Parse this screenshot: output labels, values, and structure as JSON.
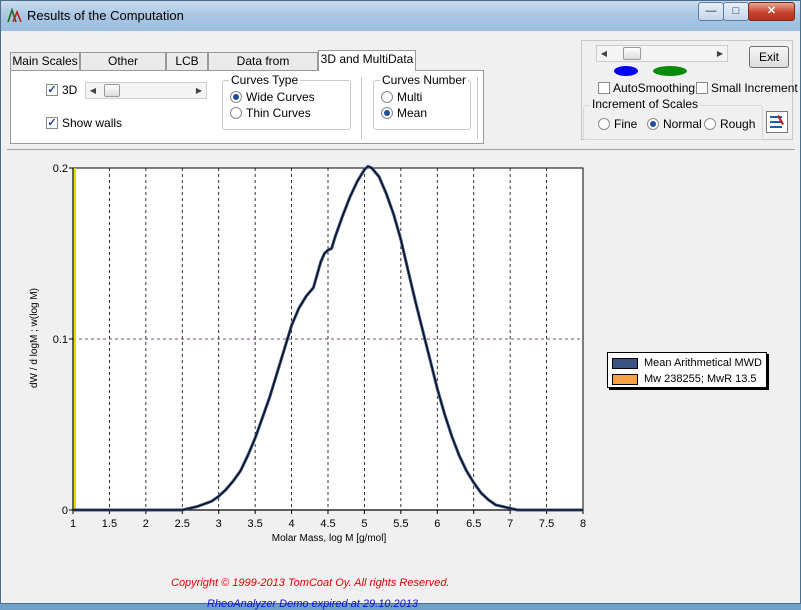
{
  "window": {
    "title": "Results of the Computation",
    "minimize_glyph": "—",
    "maximize_glyph": "□",
    "close_glyph": "✕"
  },
  "tabs": [
    {
      "label": "Main Scales",
      "active": false
    },
    {
      "label": "Other Functions",
      "active": false
    },
    {
      "label": "LCB",
      "active": false
    },
    {
      "label": "Data from DataBase",
      "active": false
    },
    {
      "label": "3D and MultiData",
      "active": true
    }
  ],
  "panel_3d": {
    "checkbox_3d": {
      "label": "3D",
      "checked": true
    },
    "checkbox_walls": {
      "label": "Show walls",
      "checked": true
    },
    "slider_position": 0.2,
    "curves_type": {
      "title": "Curves Type",
      "options": [
        {
          "label": "Wide Curves",
          "selected": true
        },
        {
          "label": "Thin Curves",
          "selected": false
        }
      ]
    },
    "curves_number": {
      "title": "Curves Number",
      "options": [
        {
          "label": "Multi",
          "selected": false
        },
        {
          "label": "Mean",
          "selected": true
        }
      ]
    }
  },
  "right_panel": {
    "exit_label": "Exit",
    "auto_smoothing_label": "AutoSmoothing",
    "small_increment_label": "Small Increment",
    "increment_title": "Increment of Scales",
    "increment_options": [
      {
        "label": "Fine",
        "selected": false
      },
      {
        "label": "Normal",
        "selected": true
      },
      {
        "label": "Rough",
        "selected": false
      }
    ],
    "slider_position": 0.2,
    "ellipse_colors": [
      "#0000ff",
      "#0a8a0a"
    ]
  },
  "chart_data": {
    "type": "line",
    "xlabel": "Molar Mass, log M [g/mol]",
    "ylabel": "dW / d logM ; w(log M)",
    "xlim": [
      1,
      8
    ],
    "ylim": [
      0,
      0.2
    ],
    "xticks": [
      "1",
      "1.5",
      "2",
      "2.5",
      "3",
      "3.5",
      "4",
      "4.5",
      "5",
      "5.5",
      "6",
      "6.5",
      "7",
      "7.5",
      "8"
    ],
    "yticks": [
      "0",
      "0.1",
      "0.2"
    ],
    "grid": true,
    "legend_placement": "right",
    "series": [
      {
        "name": "Mean Arithmetical MWD",
        "color": "#3a5384",
        "x": [
          1.0,
          2.5,
          2.7,
          2.9,
          3.0,
          3.1,
          3.2,
          3.3,
          3.4,
          3.5,
          3.6,
          3.7,
          3.8,
          3.9,
          4.0,
          4.1,
          4.2,
          4.3,
          4.4,
          4.45,
          4.5,
          4.55,
          4.6,
          4.7,
          4.8,
          4.9,
          5.0,
          5.05,
          5.1,
          5.2,
          5.3,
          5.4,
          5.5,
          5.6,
          5.7,
          5.8,
          5.9,
          6.0,
          6.1,
          6.2,
          6.3,
          6.4,
          6.5,
          6.6,
          6.7,
          6.8,
          6.9,
          7.0,
          7.1,
          7.2,
          8.0
        ],
        "y": [
          0.0,
          0.0,
          0.002,
          0.005,
          0.008,
          0.012,
          0.017,
          0.023,
          0.032,
          0.042,
          0.054,
          0.066,
          0.08,
          0.094,
          0.108,
          0.118,
          0.125,
          0.13,
          0.145,
          0.15,
          0.152,
          0.153,
          0.16,
          0.172,
          0.183,
          0.192,
          0.199,
          0.201,
          0.2,
          0.195,
          0.185,
          0.173,
          0.158,
          0.14,
          0.122,
          0.105,
          0.088,
          0.071,
          0.056,
          0.043,
          0.032,
          0.023,
          0.016,
          0.01,
          0.006,
          0.003,
          0.002,
          0.001,
          0.0,
          0.0,
          0.0
        ]
      }
    ],
    "legend_entries": [
      {
        "label": "Mean Arithmetical MWD",
        "color": "#3a5384"
      },
      {
        "label": "Mw 238255; MwR 13.5",
        "color": "#f5a347"
      }
    ],
    "vertical_marker": {
      "x": 1.0,
      "color": "#e8d800"
    }
  },
  "footer": {
    "copyright": "Copyright © 1999-2013 TomCoat Oy. All rights Reserved.",
    "expired": "RheoAnalyzer Demo expired at  29.10.2013"
  }
}
